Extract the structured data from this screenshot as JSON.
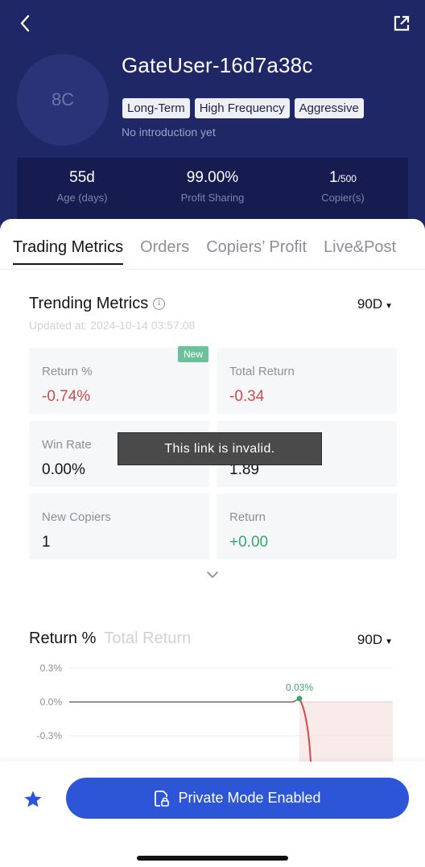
{
  "header": {
    "back_icon": "chevron-left-icon",
    "share_icon": "external-share-icon",
    "avatar_initials": "8C",
    "username": "GateUser-16d7a38c",
    "tags": [
      "Long-Term",
      "High Frequency",
      "Aggressive"
    ],
    "introduction": "No introduction yet",
    "stats": [
      {
        "value": "55d",
        "label": "Age (days)"
      },
      {
        "value": "99.00%",
        "label": "Profit Sharing"
      },
      {
        "value_main": "1",
        "value_sub": "/500",
        "label": "Copier(s)"
      }
    ],
    "bg_color": "#1f2766"
  },
  "tabs": [
    "Trading Metrics",
    "Orders",
    "Copiers’ Profit",
    "Live&Post"
  ],
  "active_tab": "Trading Metrics",
  "metrics_section": {
    "title": "Trending Metrics",
    "period": "90D",
    "updated": "Updated at: 2024-10-14 03:57:08",
    "new_badge": "New",
    "items": [
      {
        "label": "Return %",
        "value": "-0.74%",
        "tone": "negative"
      },
      {
        "label": "Total Return",
        "value": "-0.34",
        "tone": "negative"
      },
      {
        "label": "Win Rate",
        "value": "0.00%",
        "tone": "neutral"
      },
      {
        "label": "",
        "value": "1.89",
        "tone": "neutral"
      },
      {
        "label": "New Copiers",
        "value": "1",
        "tone": "neutral"
      },
      {
        "label": "Return",
        "value": "+0.00",
        "tone": "positive"
      }
    ]
  },
  "toast": "This link is invalid.",
  "chart_section": {
    "tabs": [
      "Return %",
      "Total Return"
    ],
    "active_tab": "Return %",
    "period": "90D"
  },
  "chart_data": {
    "type": "line",
    "title": "",
    "xlabel": "",
    "ylabel": "",
    "y_ticks": [
      "0.3%",
      "0.0%",
      "-0.3%"
    ],
    "ylim": [
      -0.3,
      0.3
    ],
    "series": [
      {
        "values": [
          0.0,
          0.0,
          0.0,
          0.0,
          0.0,
          0.0,
          0.0,
          0.0,
          0.03,
          -0.74
        ]
      }
    ],
    "annotations": [
      {
        "label": "0.03%",
        "value": 0.03
      }
    ],
    "grid": true,
    "colors": {
      "line_flat": "#8b6a5a",
      "line_down": "#cf4b4b",
      "marker": "#3aa66e",
      "fill": "#f6dada"
    }
  },
  "bottom_bar": {
    "star_icon": "star-icon",
    "button_label": "Private Mode Enabled",
    "button_icon": "private-lock-icon",
    "button_color": "#2d55d8"
  }
}
